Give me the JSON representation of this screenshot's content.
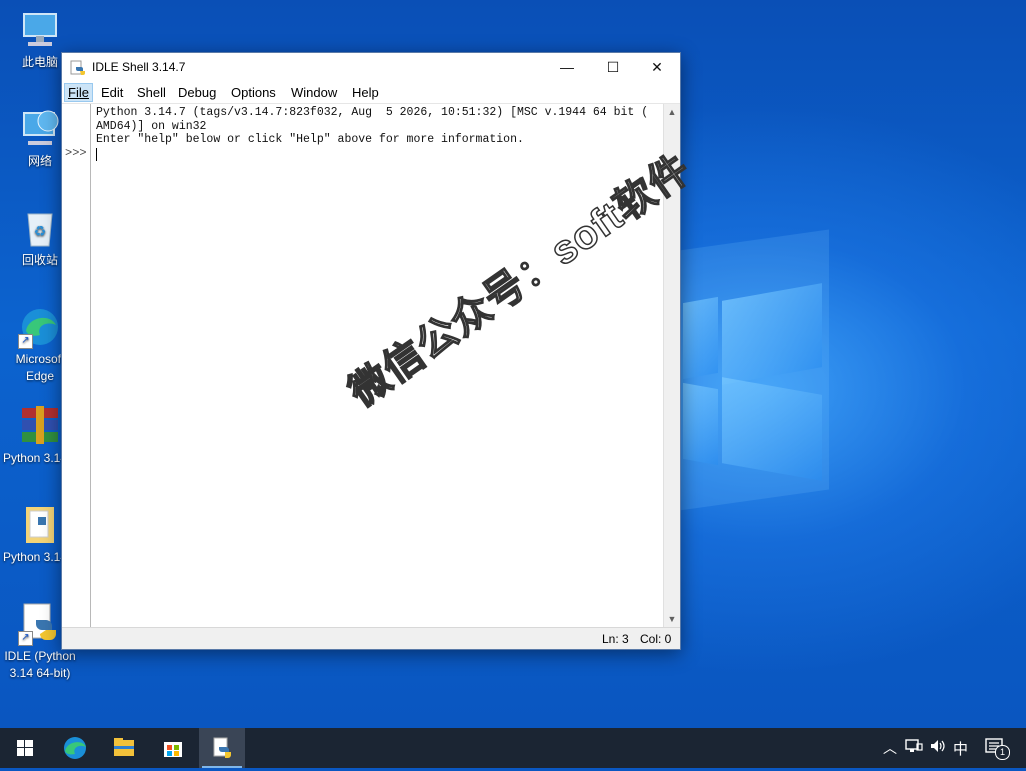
{
  "desktop": {
    "icons": [
      {
        "label": "此电脑"
      },
      {
        "label": "网络"
      },
      {
        "label": "回收站"
      },
      {
        "label": "Microsoft Edge"
      },
      {
        "label": "Python 3.14.7"
      },
      {
        "label": "Python 3.14.7"
      },
      {
        "label": "IDLE (Python 3.14 64-bit)"
      }
    ]
  },
  "window": {
    "title": "IDLE Shell 3.14.7",
    "controls": {
      "minimize": "—",
      "maximize": "☐",
      "close": "✕"
    },
    "menu": [
      {
        "label": "File",
        "selected": true
      },
      {
        "label": "Edit"
      },
      {
        "label": "Shell"
      },
      {
        "label": "Debug"
      },
      {
        "label": "Options"
      },
      {
        "label": "Window"
      },
      {
        "label": "Help"
      }
    ],
    "shell": {
      "banner_line1": "Python 3.14.7 (tags/v3.14.7:823f032, Aug  5 2026, 10:51:32) [MSC v.1944 64 bit (",
      "banner_line2": "AMD64)] on win32",
      "banner_line3": "Enter \"help\" below or click \"Help\" above for more information.",
      "prompt": ">>>"
    },
    "status": {
      "line": "Ln: 3",
      "col": "Col: 0"
    }
  },
  "taskbar": {
    "tray_ime": "中",
    "notification_count": "1"
  },
  "watermark": "微信公众号：soft软件"
}
